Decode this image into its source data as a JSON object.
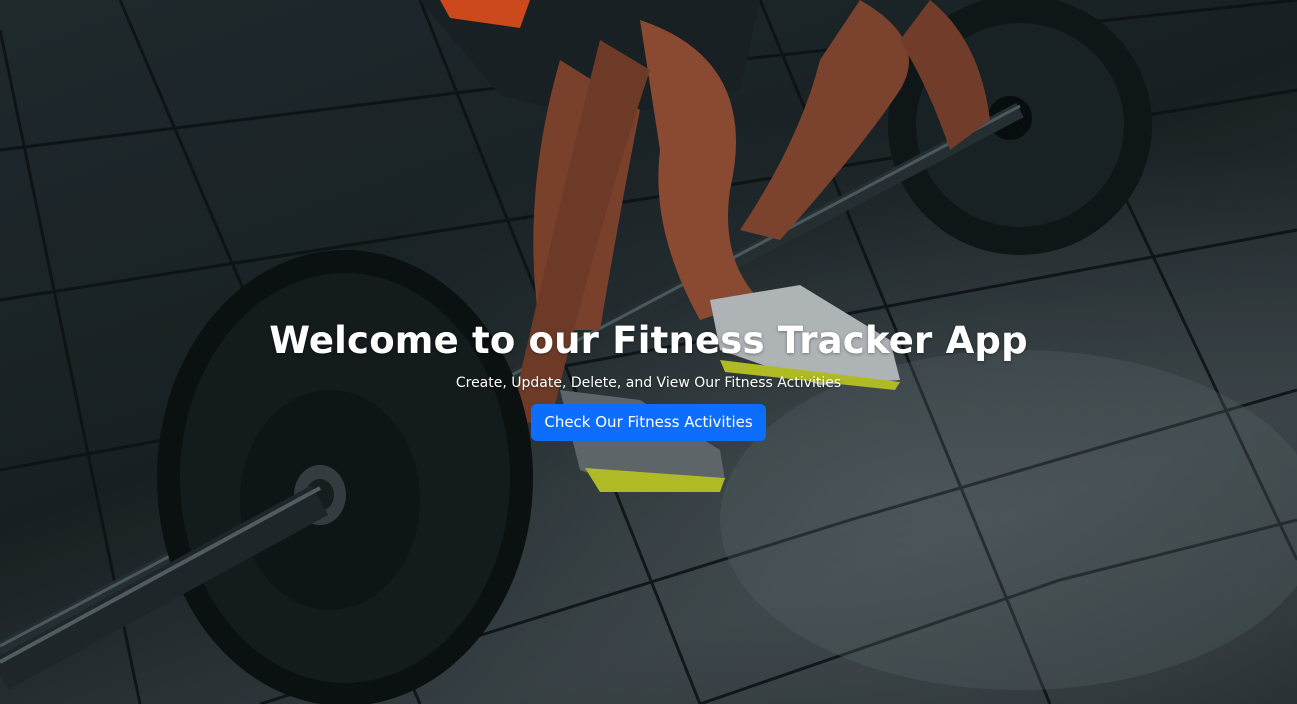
{
  "hero": {
    "title": "Welcome to our Fitness Tracker App",
    "subtitle": "Create, Update, Delete, and View Our Fitness Activities",
    "cta_label": "Check Our Fitness Activities",
    "background_image": "weightlifter-barbell-deadlift-photo"
  },
  "colors": {
    "button_primary": "#0d6efd",
    "text": "#ffffff",
    "floor": "#243034",
    "shorts_stripe": "#ff5a1f",
    "shoe_sole": "#c8d42a"
  }
}
